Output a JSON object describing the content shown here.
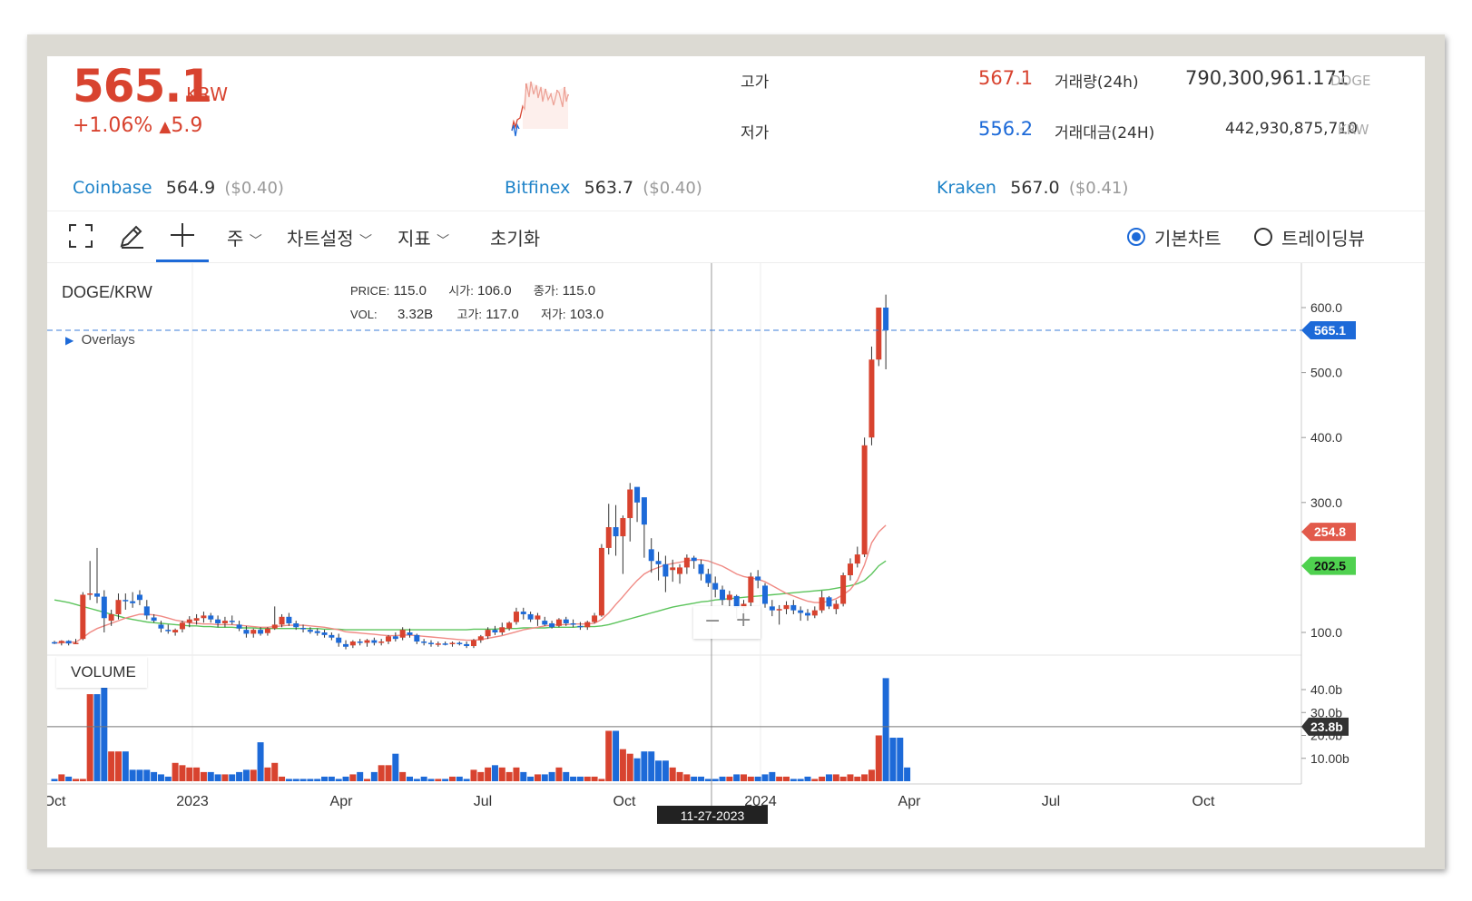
{
  "ticker": {
    "price": "565.1",
    "unit": "KRW",
    "change_pct": "+1.06%",
    "change_arrow": "▲",
    "change_abs": "5.9"
  },
  "stats": {
    "high_label": "고가",
    "high_value": "567.1",
    "low_label": "저가",
    "low_value": "556.2",
    "volume_label": "거래량(24h)",
    "volume_value": "790,300,961.171",
    "volume_unit": "DOGE",
    "turnover_label": "거래대금(24H)",
    "turnover_value": "442,930,875,710",
    "turnover_unit": "KRW"
  },
  "exchanges": [
    {
      "name": "Coinbase",
      "price": "564.9",
      "usd": "($0.40)"
    },
    {
      "name": "Bitfinex",
      "price": "563.7",
      "usd": "($0.40)"
    },
    {
      "name": "Kraken",
      "price": "567.0",
      "usd": "($0.41)"
    }
  ],
  "toolbar": {
    "period": "주",
    "settings": "차트설정",
    "indicators": "지표",
    "reset": "초기화",
    "basic_chart": "기본차트",
    "tradingview": "트레이딩뷰"
  },
  "colors": {
    "up": "#d8432f",
    "down": "#1d6ad8",
    "ma_short": "#f08a84",
    "ma_long": "#5cc45c"
  },
  "chart_data": {
    "type": "candlestick",
    "symbol": "DOGE/KRW",
    "overlays_label": "Overlays",
    "crosshair_info": {
      "price_label": "PRICE:",
      "price": "115.0",
      "open_label": "시가:",
      "open": "106.0",
      "close_label": "종가:",
      "close": "115.0",
      "vol_label": "VOL:",
      "vol": "3.32B",
      "high_label": "고가:",
      "high": "117.0",
      "low_label": "저가:",
      "low": "103.0"
    },
    "x_ticks": [
      "Oct",
      "2023",
      "Apr",
      "Jul",
      "Oct",
      "2024",
      "Apr",
      "Jul",
      "Oct"
    ],
    "crosshair_date": "11-27-2023",
    "y_ticks": [
      "600.0",
      "500.0",
      "400.0",
      "300.0",
      "100.0"
    ],
    "ylim": [
      70,
      660
    ],
    "price_markers": [
      {
        "value": "565.1",
        "color": "#1d6ad8"
      },
      {
        "value": "254.8",
        "color": "#e25a4b"
      },
      {
        "value": "202.5",
        "color": "#4fd14f"
      }
    ],
    "volume_label": "VOLUME",
    "volume_ticks": [
      "40.0b",
      "30.0b",
      "20.0b",
      "10.00b"
    ],
    "volume_marker": "23.8b",
    "volume_ylim": [
      0,
      50
    ],
    "candles": [
      [
        85,
        87,
        82,
        84
      ],
      [
        84,
        88,
        80,
        87
      ],
      [
        87,
        88,
        80,
        83
      ],
      [
        83,
        90,
        82,
        84
      ],
      [
        90,
        162,
        88,
        158
      ],
      [
        158,
        210,
        150,
        160
      ],
      [
        160,
        230,
        145,
        155
      ],
      [
        155,
        165,
        100,
        122
      ],
      [
        118,
        135,
        110,
        128
      ],
      [
        128,
        160,
        120,
        150
      ],
      [
        150,
        160,
        135,
        148
      ],
      [
        148,
        162,
        138,
        145
      ],
      [
        158,
        165,
        142,
        150
      ],
      [
        140,
        150,
        120,
        126
      ],
      [
        123,
        128,
        115,
        118
      ],
      [
        112,
        118,
        100,
        106
      ],
      [
        104,
        112,
        98,
        102
      ],
      [
        100,
        106,
        95,
        104
      ],
      [
        105,
        118,
        100,
        115
      ],
      [
        115,
        125,
        108,
        120
      ],
      [
        118,
        128,
        112,
        122
      ],
      [
        122,
        132,
        115,
        126
      ],
      [
        126,
        130,
        115,
        120
      ],
      [
        120,
        126,
        108,
        114
      ],
      [
        114,
        124,
        108,
        118
      ],
      [
        118,
        126,
        112,
        116
      ],
      [
        112,
        118,
        102,
        106
      ],
      [
        104,
        110,
        92,
        98
      ],
      [
        98,
        106,
        92,
        104
      ],
      [
        104,
        108,
        95,
        98
      ],
      [
        99,
        108,
        95,
        106
      ],
      [
        106,
        140,
        104,
        112
      ],
      [
        112,
        128,
        108,
        124
      ],
      [
        124,
        130,
        110,
        114
      ],
      [
        114,
        118,
        104,
        108
      ],
      [
        107,
        112,
        100,
        105
      ],
      [
        104,
        108,
        98,
        101
      ],
      [
        102,
        106,
        95,
        99
      ],
      [
        100,
        104,
        92,
        96
      ],
      [
        96,
        100,
        88,
        92
      ],
      [
        92,
        98,
        78,
        84
      ],
      [
        82,
        88,
        74,
        78
      ],
      [
        80,
        88,
        76,
        86
      ],
      [
        86,
        90,
        80,
        84
      ],
      [
        84,
        90,
        78,
        88
      ],
      [
        88,
        92,
        80,
        84
      ],
      [
        84,
        90,
        80,
        86
      ],
      [
        86,
        96,
        82,
        94
      ],
      [
        94,
        100,
        86,
        90
      ],
      [
        92,
        108,
        88,
        104
      ],
      [
        100,
        106,
        92,
        96
      ],
      [
        96,
        98,
        82,
        86
      ],
      [
        86,
        90,
        80,
        84
      ],
      [
        84,
        88,
        78,
        82
      ],
      [
        82,
        86,
        78,
        83
      ],
      [
        83,
        86,
        80,
        82
      ],
      [
        82,
        86,
        78,
        84
      ],
      [
        84,
        86,
        80,
        82
      ],
      [
        82,
        86,
        76,
        79
      ],
      [
        79,
        90,
        76,
        88
      ],
      [
        88,
        96,
        84,
        94
      ],
      [
        94,
        108,
        90,
        104
      ],
      [
        104,
        110,
        96,
        100
      ],
      [
        100,
        115,
        96,
        108
      ],
      [
        106,
        117,
        103,
        115
      ],
      [
        116,
        138,
        112,
        132
      ],
      [
        132,
        138,
        120,
        128
      ],
      [
        128,
        132,
        116,
        120
      ],
      [
        120,
        130,
        110,
        126
      ],
      [
        118,
        124,
        110,
        112
      ],
      [
        114,
        118,
        106,
        108
      ],
      [
        110,
        122,
        108,
        120
      ],
      [
        120,
        124,
        110,
        114
      ],
      [
        114,
        120,
        108,
        112
      ],
      [
        110,
        116,
        104,
        108
      ],
      [
        108,
        118,
        104,
        116
      ],
      [
        116,
        130,
        114,
        126
      ],
      [
        126,
        236,
        124,
        230
      ],
      [
        230,
        298,
        220,
        262
      ],
      [
        262,
        296,
        218,
        248
      ],
      [
        248,
        280,
        190,
        276
      ],
      [
        276,
        330,
        240,
        320
      ],
      [
        324,
        318,
        270,
        300
      ],
      [
        308,
        280,
        215,
        266
      ],
      [
        228,
        245,
        192,
        210
      ],
      [
        210,
        224,
        180,
        205
      ],
      [
        205,
        218,
        162,
        186
      ],
      [
        196,
        212,
        178,
        200
      ],
      [
        190,
        205,
        175,
        200
      ],
      [
        200,
        220,
        190,
        215
      ],
      [
        215,
        218,
        198,
        210
      ],
      [
        205,
        212,
        180,
        190
      ],
      [
        190,
        198,
        170,
        176
      ],
      [
        176,
        186,
        154,
        166
      ],
      [
        166,
        172,
        142,
        150
      ],
      [
        150,
        164,
        140,
        158
      ],
      [
        156,
        158,
        122,
        138
      ],
      [
        138,
        150,
        128,
        144
      ],
      [
        146,
        192,
        140,
        186
      ],
      [
        186,
        196,
        168,
        180
      ],
      [
        172,
        176,
        138,
        144
      ],
      [
        140,
        150,
        125,
        134
      ],
      [
        134,
        142,
        112,
        136
      ],
      [
        136,
        148,
        128,
        142
      ],
      [
        142,
        150,
        128,
        134
      ],
      [
        134,
        140,
        118,
        130
      ],
      [
        130,
        136,
        118,
        126
      ],
      [
        126,
        140,
        122,
        134
      ],
      [
        134,
        164,
        130,
        154
      ],
      [
        154,
        156,
        136,
        140
      ],
      [
        136,
        150,
        128,
        144
      ],
      [
        144,
        192,
        140,
        188
      ],
      [
        188,
        214,
        180,
        206
      ],
      [
        206,
        232,
        200,
        220
      ],
      [
        220,
        400,
        216,
        388
      ],
      [
        400,
        540,
        388,
        520
      ],
      [
        520,
        600,
        510,
        600
      ],
      [
        600,
        620,
        505,
        565
      ]
    ],
    "volumes": [
      1,
      3,
      2,
      1,
      1,
      38,
      38,
      42,
      13,
      13,
      13,
      5,
      5,
      5,
      4,
      3,
      2,
      8,
      7,
      6,
      6,
      4,
      4,
      3,
      3,
      3,
      4,
      5,
      5,
      17,
      6,
      8,
      2,
      1,
      1,
      1,
      1,
      1,
      2,
      2,
      1,
      2,
      3,
      4,
      1,
      4,
      7,
      7,
      12,
      4,
      2,
      1,
      2,
      1,
      1,
      1,
      2,
      2,
      1,
      5,
      4,
      6,
      7,
      6,
      4,
      6,
      4,
      2,
      3,
      3,
      4,
      6,
      4,
      2,
      2,
      2,
      2,
      1,
      22,
      22,
      14,
      12,
      10,
      13,
      13,
      9,
      9,
      6,
      4,
      3,
      2,
      2,
      1,
      1,
      2,
      2,
      3,
      3,
      2,
      2,
      3,
      4,
      2,
      2,
      1,
      1,
      2,
      1,
      2,
      3,
      3,
      2,
      3,
      2,
      3,
      5,
      20,
      45,
      19,
      19,
      6
    ],
    "ma_short": [
      84,
      84,
      85,
      85,
      92,
      100,
      106,
      110,
      114,
      118,
      122,
      125,
      128,
      128,
      127,
      125,
      122,
      119,
      117,
      115,
      114,
      113,
      113,
      112,
      112,
      112,
      111,
      110,
      109,
      108,
      108,
      109,
      110,
      111,
      111,
      111,
      110,
      109,
      108,
      106,
      104,
      101,
      100,
      99,
      98,
      97,
      96,
      95,
      95,
      96,
      96,
      95,
      94,
      93,
      92,
      91,
      90,
      89,
      88,
      88,
      89,
      91,
      93,
      95,
      98,
      101,
      104,
      106,
      108,
      110,
      111,
      112,
      112,
      113,
      113,
      113,
      114,
      120,
      130,
      143,
      155,
      168,
      180,
      190,
      196,
      200,
      204,
      206,
      208,
      210,
      212,
      212,
      210,
      206,
      202,
      196,
      190,
      186,
      184,
      182,
      178,
      172,
      166,
      160,
      156,
      152,
      148,
      146,
      146,
      148,
      152,
      158,
      166,
      180,
      204,
      238,
      254.8,
      265
    ],
    "ma_long": [
      150,
      148,
      146,
      143,
      140,
      137,
      134,
      131,
      128,
      125,
      122,
      120,
      118,
      116,
      115,
      114,
      113,
      112,
      111,
      110,
      110,
      109,
      109,
      108,
      108,
      108,
      107,
      107,
      107,
      106,
      106,
      106,
      106,
      106,
      106,
      106,
      106,
      106,
      105,
      105,
      105,
      104,
      104,
      104,
      104,
      104,
      104,
      104,
      104,
      104,
      104,
      104,
      104,
      104,
      104,
      104,
      104,
      104,
      104,
      105,
      105,
      105,
      105,
      106,
      106,
      106,
      107,
      107,
      107,
      107,
      108,
      108,
      108,
      108,
      109,
      109,
      109,
      110,
      112,
      115,
      118,
      121,
      124,
      127,
      130,
      133,
      136,
      139,
      141,
      143,
      145,
      147,
      148,
      150,
      151,
      152,
      153,
      154,
      155,
      156,
      157,
      158,
      159,
      160,
      161,
      162,
      163,
      164,
      165,
      166,
      168,
      170,
      172,
      175,
      180,
      190,
      202.5,
      210
    ]
  }
}
